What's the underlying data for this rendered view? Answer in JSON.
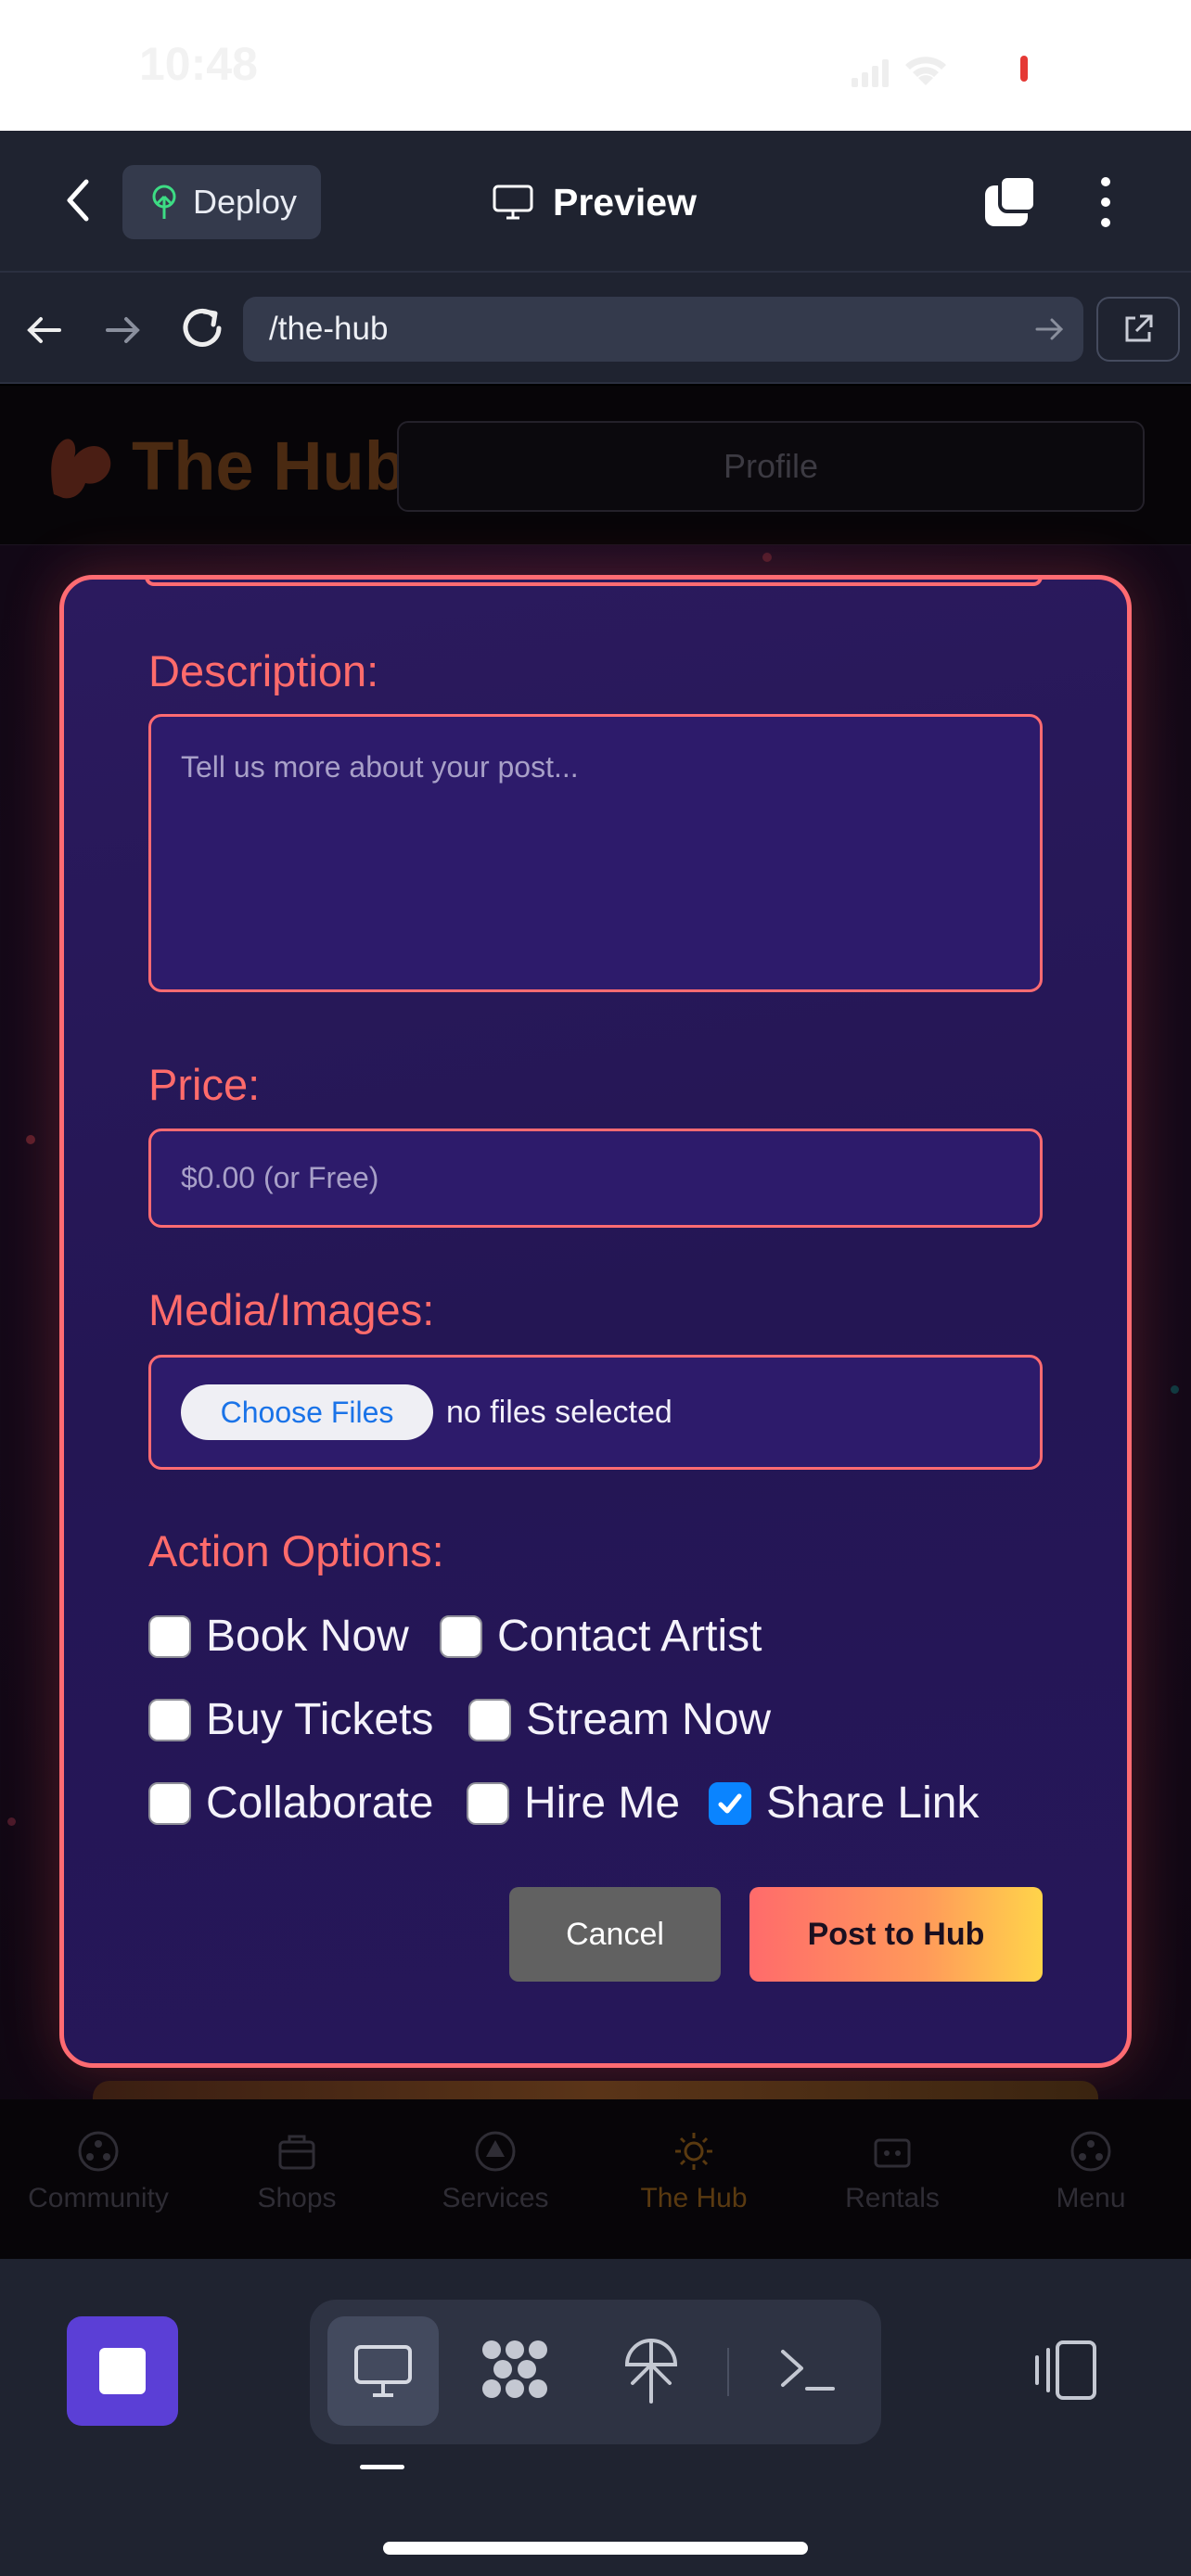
{
  "status_bar": {
    "time": "10:48"
  },
  "app_header": {
    "deploy_label": "Deploy",
    "preview_label": "Preview"
  },
  "browser": {
    "url": "/the-hub"
  },
  "page": {
    "brand": "The Hub",
    "profile_label": "Profile"
  },
  "modal": {
    "description_label": "Description:",
    "description_placeholder": "Tell us more about your post...",
    "price_label": "Price:",
    "price_placeholder": "$0.00 (or Free)",
    "media_label": "Media/Images:",
    "choose_files_label": "Choose Files",
    "no_files_text": "no files selected",
    "action_options_label": "Action Options:",
    "options": [
      {
        "label": "Book Now",
        "checked": false
      },
      {
        "label": "Contact Artist",
        "checked": false
      },
      {
        "label": "Buy Tickets",
        "checked": false
      },
      {
        "label": "Stream Now",
        "checked": false
      },
      {
        "label": "Collaborate",
        "checked": false
      },
      {
        "label": "Hire Me",
        "checked": false
      },
      {
        "label": "Share Link",
        "checked": true
      }
    ],
    "cancel_label": "Cancel",
    "post_label": "Post to Hub"
  },
  "bottom_nav": [
    {
      "label": "Community",
      "icon": "community-icon"
    },
    {
      "label": "Shops",
      "icon": "shop-icon"
    },
    {
      "label": "Services",
      "icon": "services-icon"
    },
    {
      "label": "The Hub",
      "icon": "hub-sun-icon",
      "active": true
    },
    {
      "label": "Rentals",
      "icon": "rentals-icon"
    },
    {
      "label": "Menu",
      "icon": "menu-icon"
    }
  ],
  "colors": {
    "accent": "#ff6b72",
    "modal_bg": "#241654",
    "checkbox_on": "#0a84ff",
    "stop_button": "#5b3fd6"
  }
}
